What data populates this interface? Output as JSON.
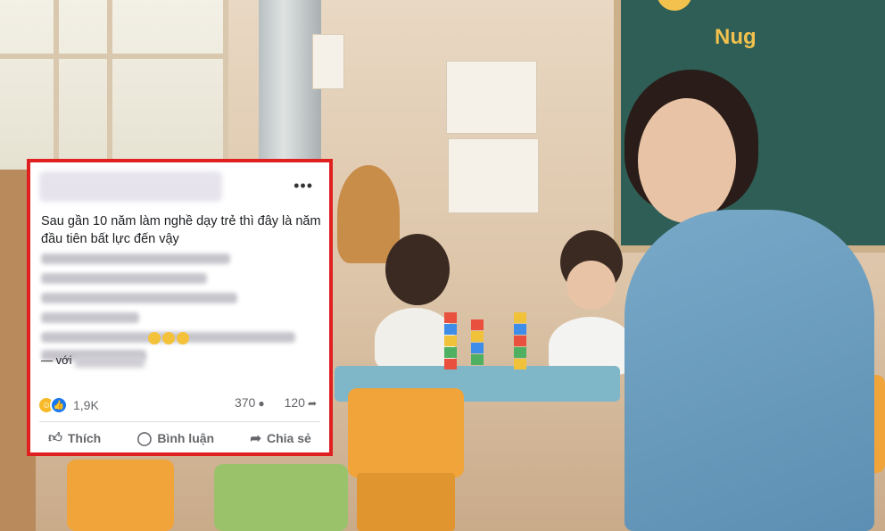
{
  "post": {
    "more_label": "•••",
    "text_line_1": "Sau gần 10 năm làm nghề dạy trẻ thì đây là năm",
    "text_line_2": "đầu tiên bất lực đến vậy",
    "with_prefix": "— với",
    "reaction_count": "1,9K",
    "comment_count": "370",
    "share_count": "120",
    "actions": {
      "like": "Thích",
      "comment": "Bình luận",
      "share": "Chia sẻ"
    }
  },
  "scene": {
    "board_text": "Nug"
  },
  "colors": {
    "highlight_border": "#e02020",
    "fb_text": "#1c1e21",
    "fb_muted": "#65676b",
    "fb_like": "#1877f2",
    "fb_haha": "#f7b928"
  },
  "icons": {
    "more": "ellipsis-icon",
    "haha": "haha-reaction-icon",
    "like_reaction": "like-reaction-icon",
    "comment_stat": "comment-bubble-icon",
    "share_stat": "share-arrow-icon",
    "like_action": "thumbs-up-icon",
    "comment_action": "comment-icon",
    "share_action": "share-icon"
  }
}
